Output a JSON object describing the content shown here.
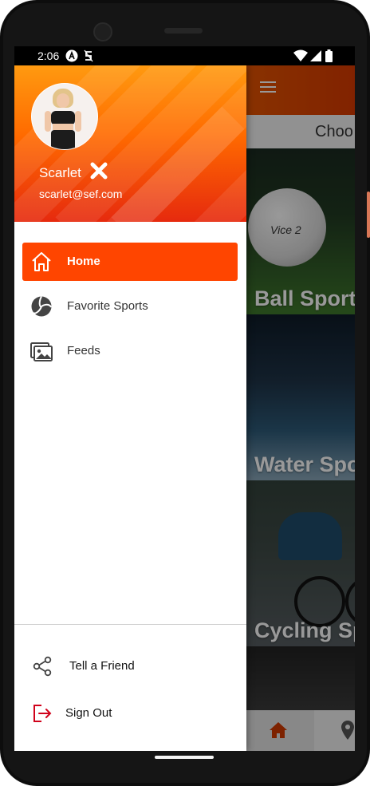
{
  "status_bar": {
    "time": "2:06",
    "icons": [
      "notification-a-icon",
      "sync-s-icon",
      "wifi-icon",
      "cellular-icon",
      "battery-icon"
    ]
  },
  "drawer": {
    "user": {
      "name": "Scarlet",
      "email": "scarlet@sef.com"
    },
    "menu": [
      {
        "label": "Home",
        "icon": "home-icon",
        "active": true
      },
      {
        "label": "Favorite Sports",
        "icon": "volleyball-icon",
        "active": false
      },
      {
        "label": "Feeds",
        "icon": "images-icon",
        "active": false
      }
    ],
    "footer": [
      {
        "label": "Tell a Friend",
        "icon": "share-icon"
      },
      {
        "label": "Sign Out",
        "icon": "sign-out-icon"
      }
    ]
  },
  "background_screen": {
    "choose_text": "Choo",
    "cards": [
      {
        "label": "Ball Sport"
      },
      {
        "label": "Water Spo"
      },
      {
        "label": "Cycling Sp"
      }
    ],
    "golf_ball_text": "Vice 2",
    "bottom_nav": [
      "home-icon",
      "location-pin-icon"
    ]
  },
  "colors": {
    "accent": "#ff4500",
    "header_gradient_top": "#ff9a10",
    "header_gradient_bottom": "#e62a0e",
    "sign_out_icon": "#d0021b"
  }
}
